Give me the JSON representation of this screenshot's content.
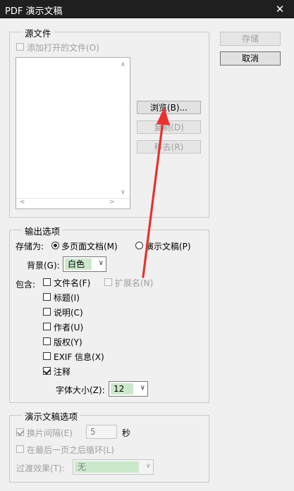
{
  "window": {
    "title": "PDF 演示文稿"
  },
  "actions": {
    "save_label": "存储",
    "cancel_label": "取消"
  },
  "source": {
    "legend": "源文件",
    "add_open_files_label": "添加打开的文件(O)",
    "add_open_files_checked": false,
    "browse_label": "浏览(B)...",
    "duplicate_label": "复制(D)",
    "remove_label": "移去(R)"
  },
  "output": {
    "legend": "输出选项",
    "save_as_label": "存储为:",
    "multipage_label": "多页面文档(M)",
    "presentation_label": "演示文稿(P)",
    "selected": "multipage",
    "background_label": "背景(G):",
    "background_value": "白色",
    "include_label": "包含:",
    "filename_label": "文件名(F)",
    "extension_label": "扩展名(N)",
    "title_label": "标题(I)",
    "description_label": "说明(C)",
    "author_label": "作者(U)",
    "copyright_label": "版权(Y)",
    "exif_label": "EXIF 信息(X)",
    "notes_label": "注释",
    "notes_checked": true,
    "font_size_label": "字体大小(Z):",
    "font_size_value": "12"
  },
  "presentation": {
    "legend": "演示文稿选项",
    "advance_label": "换片间隔(E)",
    "advance_checked": true,
    "advance_value": "5",
    "seconds_label": "秒",
    "loop_label": "在最后一页之后循环(L)",
    "transition_label": "过渡效果(T):",
    "transition_value": "无"
  },
  "colors": {
    "titlebar": "#1f1f1f",
    "dialog": "#f0f0f0",
    "select_highlight": "#cce8cc",
    "annotation_arrow": "#e8322d"
  },
  "icons": {
    "close": "close-icon",
    "dropdown": "chevron-down-icon",
    "scroll_up": "scroll-up-icon",
    "scroll_down": "scroll-down-icon"
  }
}
